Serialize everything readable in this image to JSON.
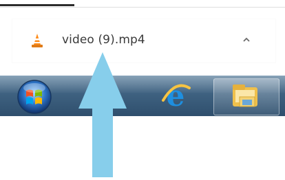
{
  "download": {
    "filename": "video (9).mp4",
    "icon": "vlc-cone-icon",
    "menu_icon": "chevron-up-icon"
  },
  "taskbar": {
    "apps": [
      {
        "name": "start-button",
        "icon": "windows-orb-icon"
      },
      {
        "name": "internet-explorer",
        "icon": "ie-icon"
      },
      {
        "name": "windows-explorer",
        "icon": "folder-icon"
      }
    ]
  },
  "annotation": {
    "arrow_color": "#87ceeb",
    "direction": "up"
  }
}
